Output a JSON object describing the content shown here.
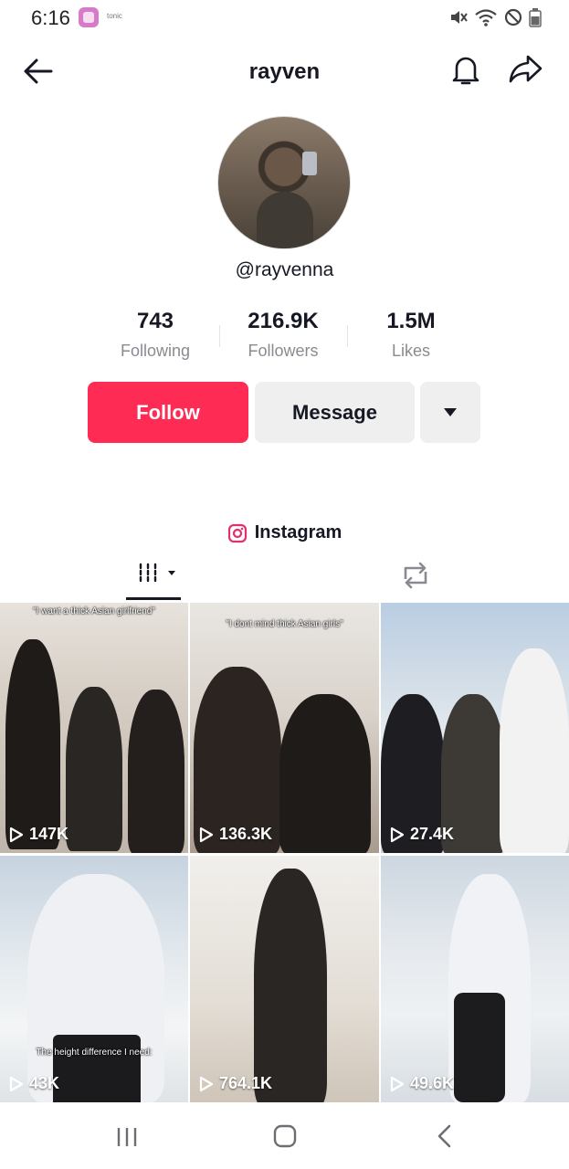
{
  "status_bar": {
    "time": "6:16",
    "app_label": "tonic"
  },
  "header": {
    "title": "rayven"
  },
  "profile": {
    "handle": "@rayvenna",
    "stats": [
      {
        "value": "743",
        "label": "Following"
      },
      {
        "value": "216.9K",
        "label": "Followers"
      },
      {
        "value": "1.5M",
        "label": "Likes"
      }
    ],
    "follow_label": "Follow",
    "message_label": "Message",
    "link_label": "Instagram"
  },
  "colors": {
    "accent": "#fe2c55",
    "secondary_button": "#efeff0",
    "text_primary": "#161823",
    "text_secondary": "#8a8b91"
  },
  "videos": [
    {
      "views": "147K",
      "caption": "\"I want a thick Asian girlfriend\""
    },
    {
      "views": "136.3K",
      "caption": "\"I dont mind thick Asian girls\""
    },
    {
      "views": "27.4K",
      "caption": ""
    },
    {
      "views": "43K",
      "caption": "The height difference I need:"
    },
    {
      "views": "764.1K",
      "caption": ""
    },
    {
      "views": "49.6K",
      "caption": ""
    }
  ]
}
